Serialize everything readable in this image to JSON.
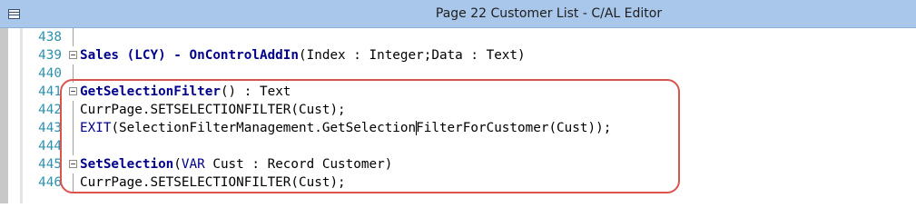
{
  "window": {
    "title": "Page 22 Customer List - C/AL Editor"
  },
  "colors": {
    "titlebar": "#a9c7ea",
    "line_number": "#2b91af",
    "function_name": "#00008b",
    "highlight_border": "#d9534f"
  },
  "lines": [
    {
      "num": "438",
      "fold": false,
      "parts": []
    },
    {
      "num": "439",
      "fold": true,
      "parts": [
        {
          "t": "Sales (LCY) - OnControlAddIn",
          "c": "fn"
        },
        {
          "t": "(Index : Integer;Data : Text)",
          "c": ""
        }
      ]
    },
    {
      "num": "440",
      "fold": false,
      "parts": []
    },
    {
      "num": "441",
      "fold": true,
      "parts": [
        {
          "t": "GetSelectionFilter",
          "c": "fn"
        },
        {
          "t": "() : Text",
          "c": ""
        }
      ]
    },
    {
      "num": "442",
      "fold": false,
      "parts": [
        {
          "t": "CurrPage.SETSELECTIONFILTER(Cust);",
          "c": ""
        }
      ]
    },
    {
      "num": "443",
      "fold": false,
      "parts": [
        {
          "t": "EXIT",
          "c": "kw"
        },
        {
          "t": "(SelectionFilterManagement.GetSelectionFilterForCustomer(Cust));",
          "c": ""
        }
      ]
    },
    {
      "num": "444",
      "fold": false,
      "parts": []
    },
    {
      "num": "445",
      "fold": true,
      "parts": [
        {
          "t": "SetSelection",
          "c": "fn"
        },
        {
          "t": "(",
          "c": ""
        },
        {
          "t": "VAR",
          "c": "kw"
        },
        {
          "t": " Cust : Record Customer)",
          "c": ""
        }
      ]
    },
    {
      "num": "446",
      "fold": false,
      "parts": [
        {
          "t": "CurrPage.SETSELECTIONFILTER(Cust);",
          "c": ""
        }
      ]
    }
  ]
}
